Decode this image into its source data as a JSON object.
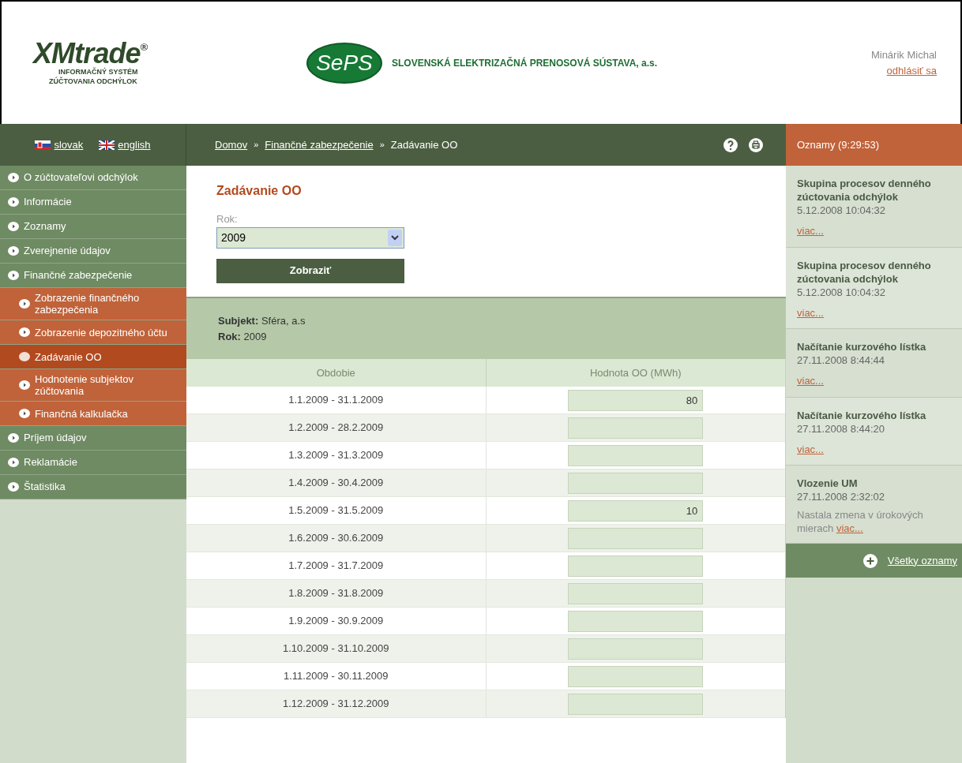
{
  "header": {
    "logo": {
      "name": "XMtrade",
      "mark": "®",
      "subtitle_1": "INFORMAČNÝ SYSTÉM",
      "subtitle_2": "ZÚČTOVANIA ODCHÝLOK"
    },
    "company": {
      "logo_text": "SePS",
      "name": "SLOVENSKÁ ELEKTRIZAČNÁ PRENOSOVÁ SÚSTAVA, a.s."
    },
    "user": {
      "name": "Minárik Michal",
      "logout": "odhlásiť sa"
    }
  },
  "languages": [
    {
      "label": "slovak",
      "kind": "sk"
    },
    {
      "label": "english",
      "kind": "gb"
    }
  ],
  "breadcrumb": [
    {
      "label": "Domov",
      "link": true
    },
    {
      "label": "Finančné zabezpečenie",
      "link": true
    },
    {
      "label": "Zadávanie OO",
      "link": false
    }
  ],
  "separator": "»",
  "announcements_title": "Oznamy (9:29:53)",
  "sidebar": {
    "items": [
      {
        "label": "O zúčtovateľovi odchýlok",
        "kind": "top",
        "selected": false
      },
      {
        "label": "Informácie",
        "kind": "top",
        "selected": false
      },
      {
        "label": "Zoznamy",
        "kind": "top",
        "selected": false
      },
      {
        "label": "Zverejnenie údajov",
        "kind": "top",
        "selected": false
      },
      {
        "label": "Finančné zabezpečenie",
        "kind": "top",
        "selected": false
      },
      {
        "label": "Zobrazenie finančného zabezpečenia",
        "kind": "sub",
        "selected": false
      },
      {
        "label": "Zobrazenie depozitného účtu",
        "kind": "sub",
        "selected": false
      },
      {
        "label": "Zadávanie OO",
        "kind": "sub",
        "selected": true
      },
      {
        "label": "Hodnotenie subjektov zúčtovania",
        "kind": "sub",
        "selected": false
      },
      {
        "label": "Finančná kalkulačka",
        "kind": "sub",
        "selected": false
      },
      {
        "label": "Príjem údajov",
        "kind": "top",
        "selected": false
      },
      {
        "label": "Reklamácie",
        "kind": "top",
        "selected": false
      },
      {
        "label": "Štatistika",
        "kind": "top",
        "selected": false
      }
    ]
  },
  "form": {
    "title": "Zadávanie OO",
    "year_label": "Rok:",
    "year_value": "2009",
    "submit": "Zobraziť"
  },
  "info": {
    "subject_label": "Subjekt:",
    "subject": "Sféra, a.s",
    "year_label": "Rok:",
    "year": "2009"
  },
  "table": {
    "columns": [
      "Obdobie",
      "Hodnota OO (MWh)"
    ],
    "rows": [
      {
        "period": "1.1.2009 - 31.1.2009",
        "value": "80"
      },
      {
        "period": "1.2.2009 - 28.2.2009"
      },
      {
        "period": "1.3.2009 - 31.3.2009"
      },
      {
        "period": "1.4.2009 - 30.4.2009"
      },
      {
        "period": "1.5.2009 - 31.5.2009",
        "value": "10"
      },
      {
        "period": "1.6.2009 - 30.6.2009"
      },
      {
        "period": "1.7.2009 - 31.7.2009"
      },
      {
        "period": "1.8.2009 - 31.8.2009"
      },
      {
        "period": "1.9.2009 - 30.9.2009"
      },
      {
        "period": "1.10.2009 - 31.10.2009"
      },
      {
        "period": "1.11.2009 - 30.11.2009"
      },
      {
        "period": "1.12.2009 - 31.12.2009"
      }
    ]
  },
  "announcements": [
    {
      "title": "Skupina procesov denného zúctovania odchýlok",
      "time": "5.12.2008 10:04:32",
      "link": "viac..."
    },
    {
      "title": "Skupina procesov denného zúctovania odchýlok",
      "time": "5.12.2008 10:04:32",
      "link": "viac..."
    },
    {
      "title": "Načítanie kurzového lístka",
      "time": "27.11.2008 8:44:44",
      "link": "viac..."
    },
    {
      "title": "Načítanie kurzového lístka",
      "time": "27.11.2008 8:44:20",
      "link": "viac..."
    },
    {
      "title": "Vlozenie UM",
      "time": "27.11.2008 2:32:02",
      "text": "Nastala zmena v úrokových mierach",
      "link": "viac..."
    }
  ],
  "all_announcements": "Všetky oznamy"
}
